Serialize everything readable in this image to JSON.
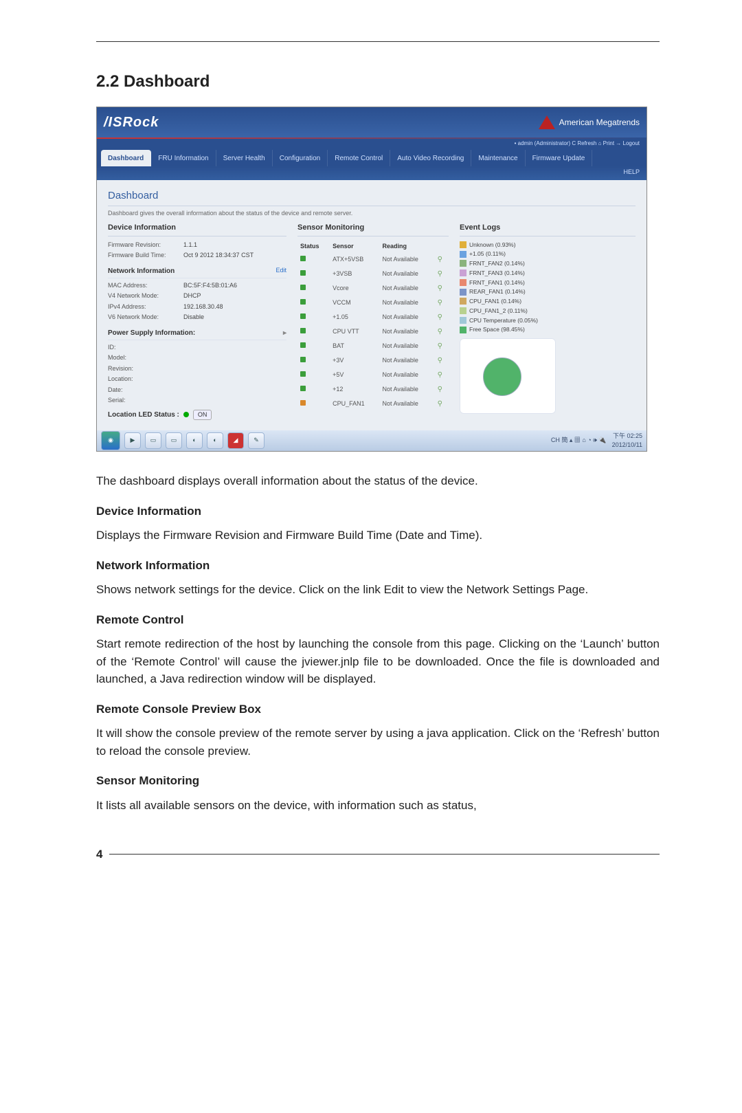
{
  "page_number": "4",
  "section_heading": "2.2  Dashboard",
  "screenshot": {
    "brand_left": "/ISRock",
    "brand_right": "American Megatrends",
    "user_row": "• admin (Administrator)   C  Refresh   ⌂ Print   → Logout",
    "nav_tabs": [
      "Dashboard",
      "FRU Information",
      "Server Health",
      "Configuration",
      "Remote Control",
      "Auto Video Recording",
      "Maintenance",
      "Firmware Update"
    ],
    "active_tab_index": 0,
    "help_label": "HELP",
    "page_title": "Dashboard",
    "subtitle": "Dashboard gives the overall information about the status of the device and remote server.",
    "device_info_heading": "Device Information",
    "firmware_rev_label": "Firmware Revision:",
    "firmware_rev_value": "1.1.1",
    "firmware_build_label": "Firmware Build Time:",
    "firmware_build_value": "Oct 9 2012 18:34:37 CST",
    "network_heading": "Network Information",
    "edit_link": "Edit",
    "net": [
      {
        "k": "MAC Address:",
        "v": "BC:5F:F4:5B:01:A6"
      },
      {
        "k": "V4 Network Mode:",
        "v": "DHCP"
      },
      {
        "k": "IPv4 Address:",
        "v": "192.168.30.48"
      },
      {
        "k": "V6 Network Mode:",
        "v": "Disable"
      }
    ],
    "psu_heading": "Power Supply Information:",
    "psu_rows": [
      "ID:",
      "Model:",
      "Revision:",
      "Location:",
      "Date:",
      "Serial:"
    ],
    "led_label": "Location LED Status :",
    "led_on": "ON",
    "sensor_heading": "Sensor Monitoring",
    "sensor_headers": [
      "Status",
      "Sensor",
      "Reading",
      ""
    ],
    "sensors": [
      {
        "s": "ok",
        "n": "ATX+5VSB",
        "r": "Not Available"
      },
      {
        "s": "ok",
        "n": "+3VSB",
        "r": "Not Available"
      },
      {
        "s": "ok",
        "n": "Vcore",
        "r": "Not Available"
      },
      {
        "s": "ok",
        "n": "VCCM",
        "r": "Not Available"
      },
      {
        "s": "ok",
        "n": "+1.05",
        "r": "Not Available"
      },
      {
        "s": "ok",
        "n": "CPU VTT",
        "r": "Not Available"
      },
      {
        "s": "ok",
        "n": "BAT",
        "r": "Not Available"
      },
      {
        "s": "ok",
        "n": "+3V",
        "r": "Not Available"
      },
      {
        "s": "ok",
        "n": "+5V",
        "r": "Not Available"
      },
      {
        "s": "ok",
        "n": "+12",
        "r": "Not Available"
      },
      {
        "s": "warn",
        "n": "CPU_FAN1",
        "r": "Not Available"
      }
    ],
    "event_heading": "Event Logs",
    "legend": [
      {
        "c": "#e0af3a",
        "t": "Unknown (0.93%)"
      },
      {
        "c": "#6aa2e0",
        "t": "+1.05 (0.11%)"
      },
      {
        "c": "#8ab37c",
        "t": "FRNT_FAN2 (0.14%)"
      },
      {
        "c": "#caa1d4",
        "t": "FRNT_FAN3 (0.14%)"
      },
      {
        "c": "#e8886e",
        "t": "FRNT_FAN1 (0.14%)"
      },
      {
        "c": "#7c94c7",
        "t": "REAR_FAN1 (0.14%)"
      },
      {
        "c": "#cfa760",
        "t": "CPU_FAN1 (0.14%)"
      },
      {
        "c": "#b8d18f",
        "t": "CPU_FAN1_2 (0.11%)"
      },
      {
        "c": "#a0c8d8",
        "t": "CPU Temperature (0.05%)"
      },
      {
        "c": "#51b36a",
        "t": "Free Space (98.45%)"
      }
    ],
    "taskbar_icons": [
      "start",
      "play",
      "folder",
      "folder",
      "globe",
      "globe",
      "flag",
      "pen"
    ],
    "tray_text": "CH 簡 ▴ ▦ ⌂  ◔ 🕪 🔌",
    "clock": "下午 02:25",
    "date": "2012/10/11"
  },
  "body": {
    "intro": "The dashboard displays overall information about the status of the device.",
    "h1": "Device Information",
    "p1": "Displays the Firmware Revision and Firmware Build Time (Date and Time).",
    "h2": "Network Information",
    "p2": "Shows network settings for the device. Click on the link Edit to view the Network Settings Page.",
    "h3": "Remote Control",
    "p3": "Start remote redirection of the host by launching the console from this page. Clicking on the ‘Launch’ button of the ‘Remote Control’ will cause the jviewer.jnlp file to be downloaded. Once the file is downloaded and launched, a Java redirection window will be displayed.",
    "h4": "Remote Console Preview Box",
    "p4": "It will show the console preview of the remote server by using a java application. Click on the ‘Refresh’ button to reload the console preview.",
    "h5": "Sensor Monitoring",
    "p5": "It lists all available sensors on the device, with information such as status,"
  }
}
